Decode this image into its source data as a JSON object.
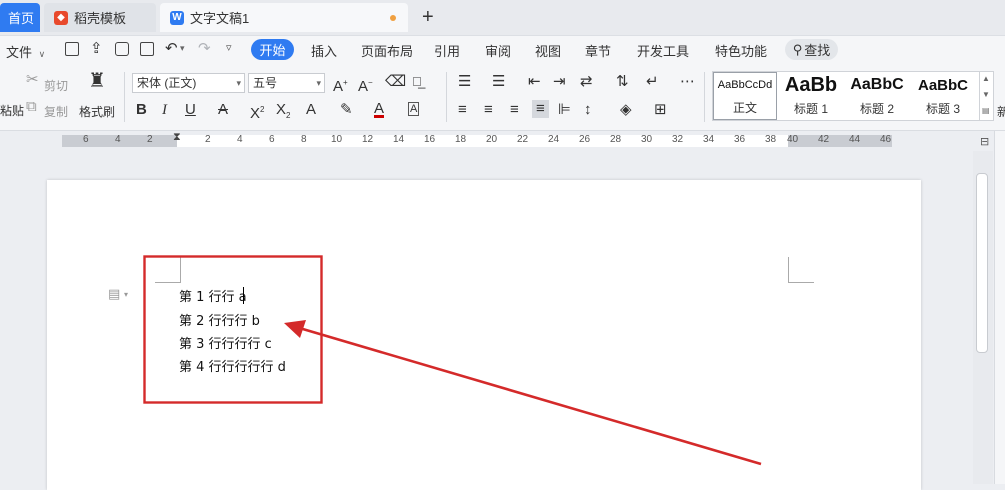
{
  "tabs": {
    "home": "首页",
    "template": "稻壳模板",
    "document": "文字文稿1",
    "new_tab": "+"
  },
  "menu": {
    "file": "文件",
    "items": [
      "开始",
      "插入",
      "页面布局",
      "引用",
      "审阅",
      "视图",
      "章节",
      "开发工具",
      "特色功能"
    ],
    "search": "查找"
  },
  "ribbon": {
    "cut": "剪切",
    "copy": "复制",
    "paste": "粘贴",
    "format_painter": "格式刷",
    "font_name": "宋体 (正文)",
    "font_size": "五号"
  },
  "styles": [
    {
      "sample": "AaBbCcDd",
      "name": "正文"
    },
    {
      "sample": "AaBb",
      "name": "标题 1"
    },
    {
      "sample": "AaBbC",
      "name": "标题 2"
    },
    {
      "sample": "AaBbC",
      "name": "标题 3"
    }
  ],
  "styles_more": "新",
  "ruler_labels": [
    "6",
    "4",
    "2",
    "2",
    "4",
    "6",
    "8",
    "10",
    "12",
    "14",
    "16",
    "18",
    "20",
    "22",
    "24",
    "26",
    "28",
    "30",
    "32",
    "34",
    "36",
    "38",
    "40",
    "42",
    "44",
    "46"
  ],
  "document": {
    "lines": [
      "第 1 行行 a",
      "第 2 行行行 b",
      "第 3 行行行行 c",
      "第 4 行行行行行 d"
    ]
  },
  "annotation": {
    "box_color": "#d42a2a",
    "arrow_color": "#d42a2a"
  },
  "colors": {
    "accent": "#2f7bf1"
  }
}
